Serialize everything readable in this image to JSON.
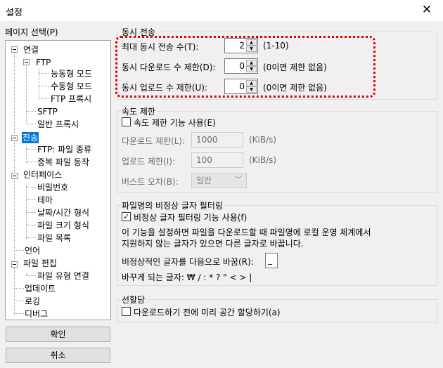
{
  "window": {
    "title": "설정",
    "close_glyph": "✕"
  },
  "tree": {
    "header": "페이지 선택(P)",
    "items": {
      "connection": "연결",
      "ftp": "FTP",
      "active_mode": "능동형 모드",
      "passive_mode": "수동형 모드",
      "ftp_proxy": "FTP 프록시",
      "sftp": "SFTP",
      "generic_proxy": "일반 프록시",
      "transfer": "전송",
      "ftp_file_types": "FTP: 파일 종류",
      "file_exists_action": "중복 파일 동작",
      "interface": "인터페이스",
      "passwords": "비밀번호",
      "themes": "테마",
      "date_time_format": "날짜/시간 형식",
      "file_size_format": "파일 크기 형식",
      "file_lists": "파일 목록",
      "language": "언어",
      "file_editing": "파일 편집",
      "filetype_associations": "파일 유형 연결",
      "updates": "업데이트",
      "logging": "로깅",
      "debug": "디버그"
    }
  },
  "buttons": {
    "ok": "확인",
    "cancel": "취소"
  },
  "concurrent": {
    "legend": "동시 전송",
    "max_label": "최대 동시 전송 수(T):",
    "max_value": "2",
    "max_hint": "(1-10)",
    "download_label": "동시 다운로드 수 제한(D):",
    "download_value": "0",
    "download_hint": "(0이면 제한 없음)",
    "upload_label": "동시 업로드 수 제한(U):",
    "upload_value": "0",
    "upload_hint": "(0이면 제한 없음)"
  },
  "speed": {
    "legend": "속도 제한",
    "enable_label": "속도 제한 기능 사용(E)",
    "enable_checked": false,
    "download_label": "다운로드 제한(L):",
    "download_value": "1000",
    "download_unit": "(KiB/s)",
    "upload_label": "업로드 제한(I):",
    "upload_value": "100",
    "upload_unit": "(KiB/s)",
    "burst_label": "버스트 오차(B):",
    "burst_value": "일반"
  },
  "filter": {
    "legend": "파일명의 비정상 글자 필터링",
    "enable_label": "비정상 글자 필터링 기능 사용(f)",
    "enable_checked": true,
    "desc_line1": "이 기능을 설정하면 파일을 다운로드할 때 파일명에 로컬 운영 체계에서",
    "desc_line2": "지원하지 않는 글자가 있으면 다른 글자로 바꿉니다.",
    "replace_label": "비정상적인 글자를 다음으로 바꿈(R):",
    "replace_value": "_",
    "replaced_chars_label": "바꾸게 되는 글자: ₩ / : * ? \" < > |"
  },
  "prealloc": {
    "legend": "선할당",
    "enable_label": "다운로드하기 전에 미리 공간 할당하기(a)",
    "enable_checked": false
  },
  "icons": {
    "check": "✓",
    "chevron": "﹀",
    "up": "▲",
    "down": "▼"
  },
  "colors": {
    "selection": "#0078d7",
    "highlight": "#e00000"
  }
}
